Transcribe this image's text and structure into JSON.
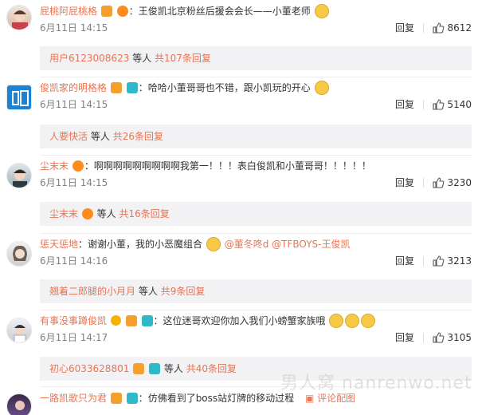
{
  "colors": {
    "username": "#eb7350",
    "subbox_bg": "#f2f2f5",
    "meta": "#808080",
    "watermark": "#c8c8c8"
  },
  "comments": [
    {
      "user": "屁桃阿屁桃格",
      "text": "王俊凯北京粉丝后援会会长——小董老师",
      "time": "6月11日 14:15",
      "reply_label": "回复",
      "likes": "8612",
      "badges": [
        "vip",
        "fans"
      ],
      "sub": {
        "user": "用户6123008623",
        "middle": "等人",
        "more": "共107条回复"
      }
    },
    {
      "user": "俊凯家的明格格",
      "text": "哈哈小董哥哥也不错，跟小凯玩的开心",
      "time": "6月11日 14:15",
      "reply_label": "回复",
      "likes": "5140",
      "badges": [
        "vip",
        "cam"
      ],
      "sub": {
        "user": "人要快活",
        "middle": "等人",
        "more": "共26条回复"
      }
    },
    {
      "user": "尘末末",
      "text": "啊啊啊啊啊啊啊啊啊我第一！！！表白俊凯和小董哥哥！！！！！",
      "time": "6月11日 14:15",
      "reply_label": "回复",
      "likes": "3230",
      "badges": [
        "fans"
      ],
      "sub": {
        "user": "尘末末",
        "middle": "等人",
        "more": "共16条回复"
      }
    },
    {
      "user": "惩天惩地",
      "text": "谢谢小董，我的小恶魔组合",
      "mention1": "@董冬咚d",
      "mention2": "@TFBOYS-王俊凯",
      "time": "6月11日 14:16",
      "reply_label": "回复",
      "likes": "3213",
      "badges": [],
      "sub": {
        "user": "翘着二郎腿的小月月",
        "middle": "等人",
        "more": "共9条回复"
      }
    },
    {
      "user": "有事没事蹲俊凯",
      "text": "这位迷哥欢迎你加入我们小螃蟹家族哦",
      "time": "6月11日 14:17",
      "reply_label": "回复",
      "likes": "3105",
      "badges": [
        "v",
        "vip",
        "cam"
      ],
      "sub": {
        "user": "初心6033628801",
        "middle": "等人",
        "more": "共40条回复"
      }
    },
    {
      "user": "一路凯歌只为君",
      "text": "仿佛看到了boss站灯牌的移动过程",
      "extra": "评论配图",
      "badges": [
        "vip",
        "cam"
      ]
    }
  ],
  "watermark": "男人窝 nanrenwo.net"
}
